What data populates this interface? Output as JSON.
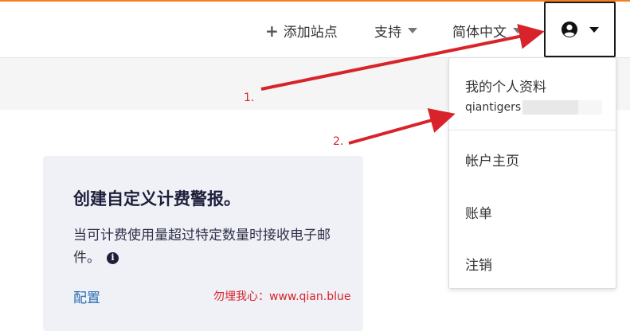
{
  "header": {
    "add_site": "添加站点",
    "support": "支持",
    "language": "简体中文"
  },
  "dropdown": {
    "profile": "我的个人资料",
    "username": "qiantigers",
    "account_home": "帐户主页",
    "billing": "账单",
    "logout": "注销"
  },
  "card": {
    "title": "创建自定义计费警报。",
    "description": "当可计费使用量超过特定数量时接收电子邮件。",
    "link": "配置"
  },
  "annotations": {
    "label_1": "1.",
    "label_2": "2.",
    "watermark": "勿埋我心：www.qian.blue"
  },
  "colors": {
    "accent": "#f38020",
    "annotation_red": "#d8232a",
    "link": "#2c6fb3",
    "card_bg": "#f0f1f7"
  }
}
